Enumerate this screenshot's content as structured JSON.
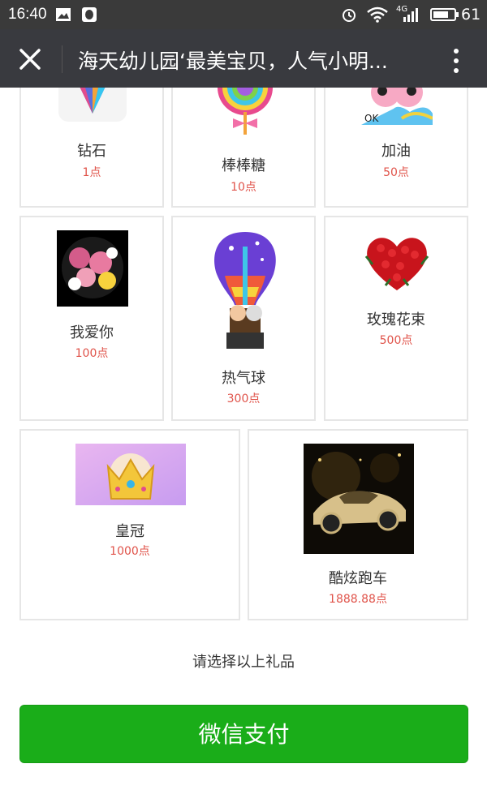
{
  "status_bar": {
    "time": "16:40",
    "network": "4G",
    "battery": "61"
  },
  "nav": {
    "title": "海天幼儿园‘最美宝贝，人气小明..."
  },
  "gifts": [
    {
      "name": "钻石",
      "price": "1点",
      "icon": "diamond-icon"
    },
    {
      "name": "棒棒糖",
      "price": "10点",
      "icon": "lollipop-icon"
    },
    {
      "name": "加油",
      "price": "50点",
      "icon": "cheer-icon"
    },
    {
      "name": "我爱你",
      "price": "100点",
      "icon": "flower-orb-icon"
    },
    {
      "name": "热气球",
      "price": "300点",
      "icon": "hot-air-balloon-icon"
    },
    {
      "name": "玫瑰花束",
      "price": "500点",
      "icon": "rose-bouquet-icon"
    },
    {
      "name": "皇冠",
      "price": "1000点",
      "icon": "crown-icon"
    },
    {
      "name": "酷炫跑车",
      "price": "1888.88点",
      "icon": "sports-car-icon"
    }
  ],
  "hint": "请选择以上礼品",
  "pay_button": "微信支付",
  "colors": {
    "price": "#e0534a",
    "pay_green": "#1aad19",
    "nav_bg": "#393a3f"
  }
}
